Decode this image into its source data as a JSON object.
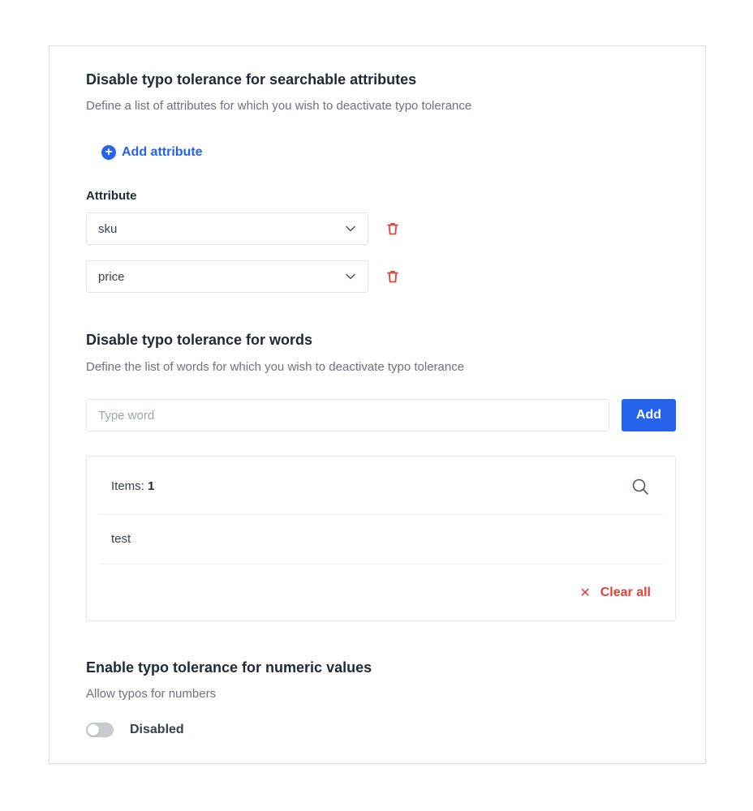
{
  "attributes_section": {
    "title": "Disable typo tolerance for searchable attributes",
    "description": "Define a list of attributes for which you wish to deactivate typo tolerance",
    "add_attribute_label": "Add attribute",
    "field_label": "Attribute",
    "selected": [
      "sku",
      "price"
    ]
  },
  "words_section": {
    "title": "Disable typo tolerance for words",
    "description": "Define the list of words for which you wish to deactivate typo tolerance",
    "input_placeholder": "Type word",
    "input_value": "",
    "add_button_label": "Add",
    "items_label": "Items:",
    "items_count": "1",
    "items": [
      "test"
    ],
    "clear_all_label": "Clear all"
  },
  "numeric_section": {
    "title": "Enable typo tolerance for numeric values",
    "description": "Allow typos for numbers",
    "toggle_label": "Disabled",
    "toggle_on": false
  },
  "colors": {
    "accent": "#2563eb",
    "danger": "#e0413a",
    "toggle_off": "#c7cbd1"
  },
  "icons": {
    "add": "plus-circle-icon",
    "dropdown": "chevron-down-icon",
    "delete": "trash-icon",
    "search": "search-icon",
    "clear": "close-icon"
  }
}
